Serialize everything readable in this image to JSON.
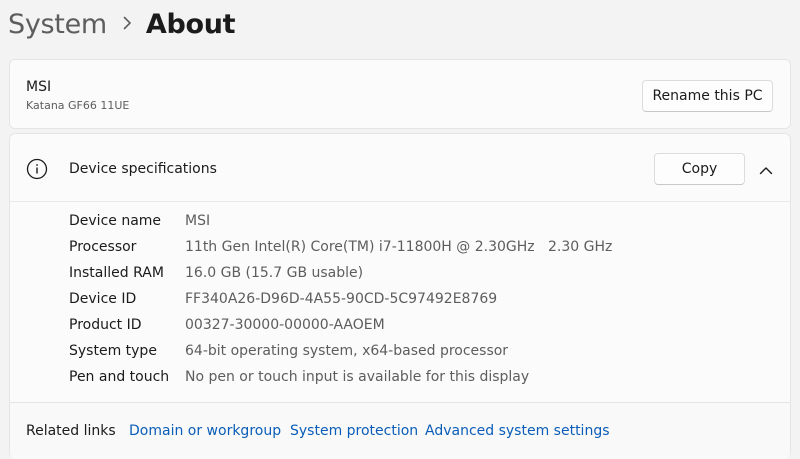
{
  "breadcrumb": {
    "parent": "System",
    "separator_icon": "chevron-right-icon",
    "current": "About"
  },
  "pc_card": {
    "name": "MSI",
    "model": "Katana GF66 11UE",
    "rename_label": "Rename this PC"
  },
  "device_specs": {
    "icon": "info-icon",
    "title": "Device specifications",
    "copy_label": "Copy",
    "collapse_icon": "chevron-up-icon",
    "rows": [
      {
        "label": "Device name",
        "value": "MSI"
      },
      {
        "label": "Processor",
        "value": "11th Gen Intel(R) Core(TM) i7-11800H @ 2.30GHz   2.30 GHz"
      },
      {
        "label": "Installed RAM",
        "value": "16.0 GB (15.7 GB usable)"
      },
      {
        "label": "Device ID",
        "value": "FF340A26-D96D-4A55-90CD-5C97492E8769"
      },
      {
        "label": "Product ID",
        "value": "00327-30000-00000-AAOEM"
      },
      {
        "label": "System type",
        "value": "64-bit operating system, x64-based processor"
      },
      {
        "label": "Pen and touch",
        "value": "No pen or touch input is available for this display"
      }
    ]
  },
  "related_links": {
    "label": "Related links",
    "links": [
      "Domain or workgroup",
      "System protection",
      "Advanced system settings"
    ]
  },
  "colors": {
    "background": "#f3f3f3",
    "card": "#fbfbfb",
    "link": "#0a5db8",
    "secondary_text": "#5d5d5d"
  }
}
